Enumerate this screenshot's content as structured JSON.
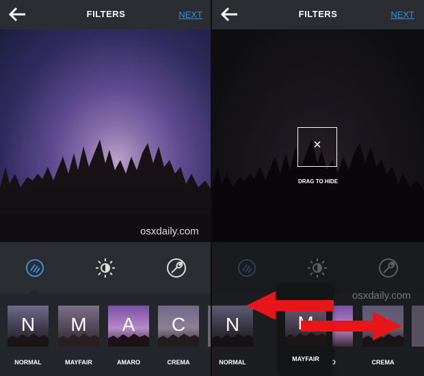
{
  "left_panel": {
    "header": {
      "title": "FILTERS",
      "next_label": "NEXT"
    },
    "watermark": "osxdaily.com",
    "filters": [
      {
        "letter": "N",
        "label": "NORMAL"
      },
      {
        "letter": "M",
        "label": "MAYFAIR"
      },
      {
        "letter": "A",
        "label": "AMARO"
      },
      {
        "letter": "C",
        "label": "CREMA"
      }
    ]
  },
  "right_panel": {
    "header": {
      "title": "FILTERS",
      "next_label": "NEXT"
    },
    "drag_hint": "DRAG TO HIDE",
    "close_glyph": "×",
    "watermark": "osxdaily.com",
    "filters": [
      {
        "letter": "N",
        "label": "NORMAL"
      },
      {
        "letter": "M",
        "label": "MAYFAIR"
      },
      {
        "letter": "C",
        "label": "CREMA"
      }
    ],
    "partial_label": "RO"
  },
  "colors": {
    "accent": "#3d8ed6",
    "arrow": "#e8161b",
    "background": "#23262b"
  },
  "icons": [
    "back-arrow-icon",
    "filter-icon",
    "brightness-icon",
    "wrench-icon",
    "close-icon"
  ]
}
